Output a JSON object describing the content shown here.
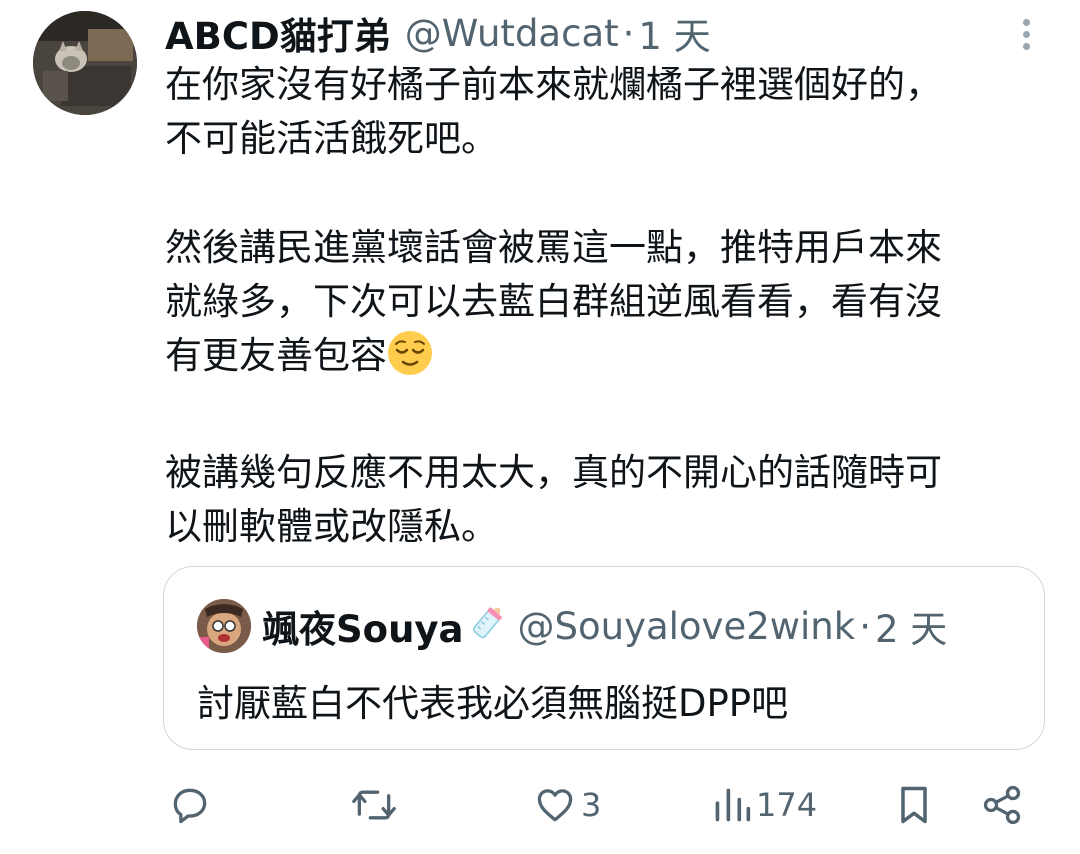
{
  "tweet": {
    "display_name": "ABCD貓打弟",
    "handle": "@Wutdacat",
    "separator": "·",
    "time": "1 天",
    "paragraphs": [
      "在你家沒有好橘子前本來就爛橘子裡選個好的，\n不可能活活餓死吧。",
      "然後講民進黨壞話會被罵這一點，推特用戶本來\n就綠多，下次可以去藍白群組逆風看看，看有沒\n有更友善包容",
      "被講幾句反應不用太大，真的不開心的話隨時可\n以刪軟體或改隱私。"
    ],
    "emoji_icon": "relieved-face-emoji"
  },
  "quote": {
    "display_name": "颯夜Souya",
    "name_emoji": "baby-bottle-emoji",
    "handle": "@Souyalove2wink",
    "separator": "·",
    "time": "2 天",
    "text": "討厭藍白不代表我必須無腦挺DPP吧"
  },
  "actions": {
    "reply_icon": "reply-icon",
    "retweet_icon": "retweet-icon",
    "like_icon": "heart-icon",
    "like_count": "3",
    "views_icon": "views-chart-icon",
    "views_count": "174",
    "bookmark_icon": "bookmark-icon",
    "share_icon": "share-icon"
  },
  "colors": {
    "text": "#0f1419",
    "secondary": "#536471",
    "border": "#cfd9de",
    "emoji": "#ffcc4d"
  }
}
